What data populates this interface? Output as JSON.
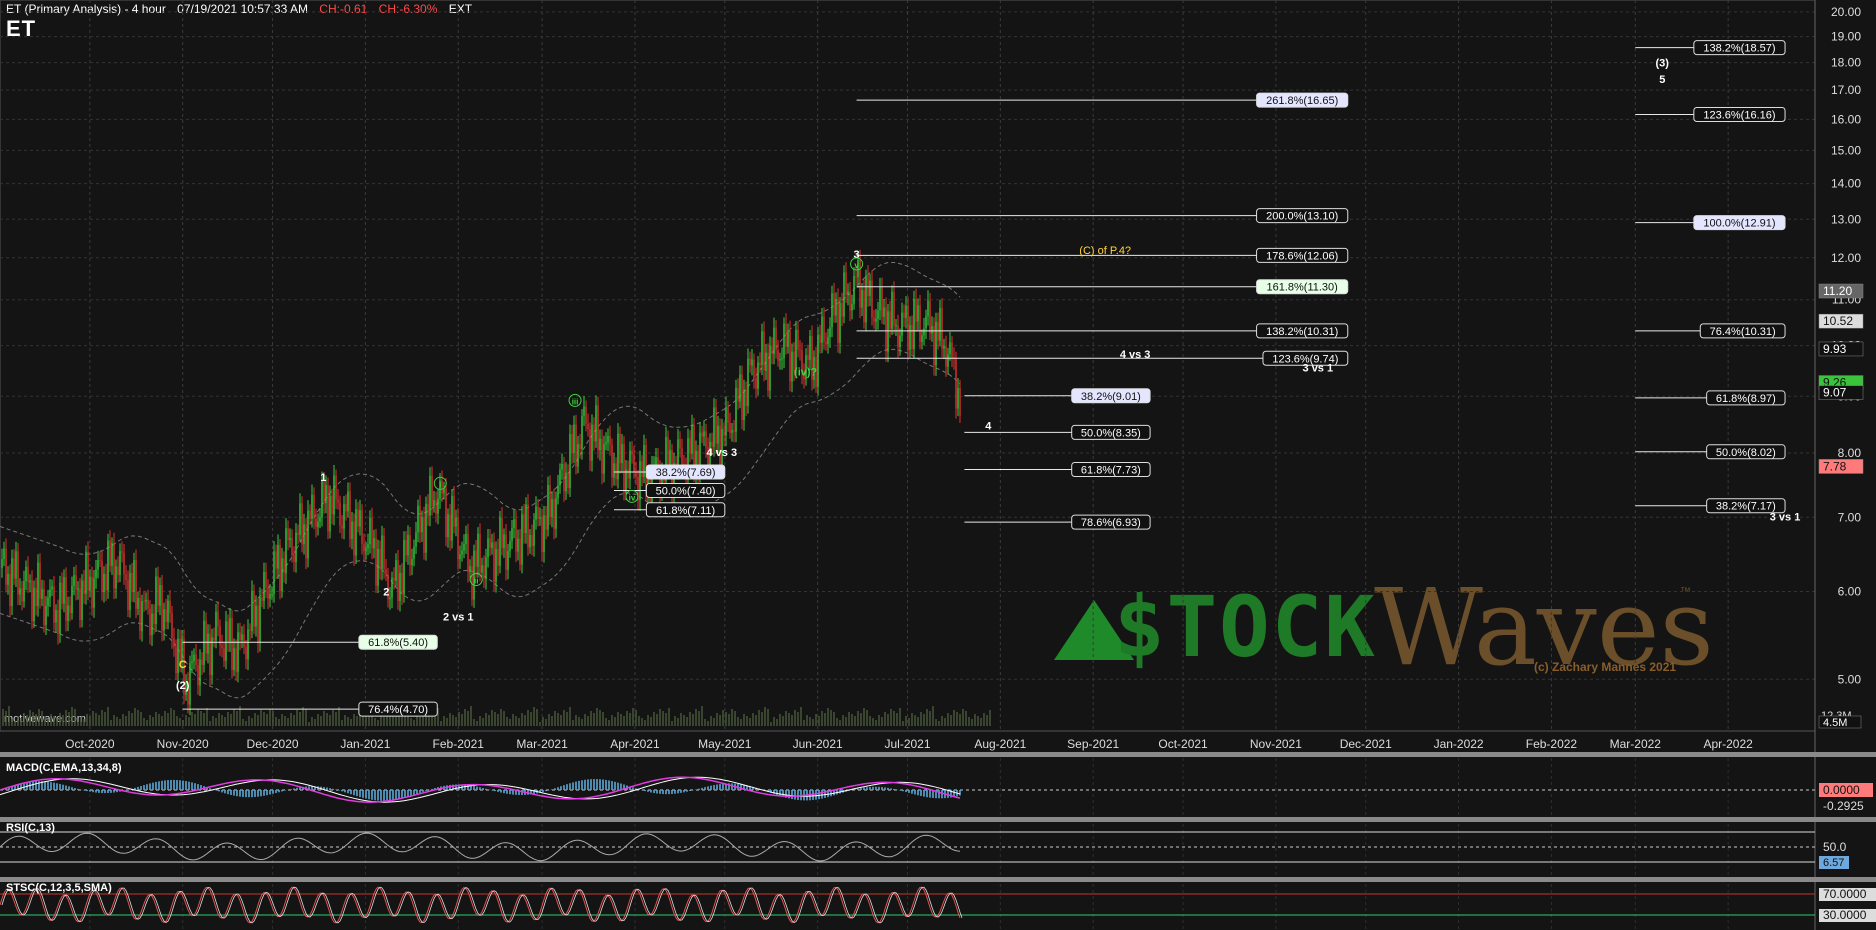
{
  "header": {
    "title": "ET (Primary Analysis) - 4 hour",
    "timestamp": "07/19/2021 10:57:33 AM",
    "ch_abs": "CH:-0.61",
    "ch_pct": "CH:-6.30%",
    "ext": "EXT",
    "symbol": "ET"
  },
  "watermark": "motivewave.com",
  "logo": {
    "brand_left": "$TOCK",
    "brand_right": "Waves",
    "tm": "™",
    "copyright": "(c) Zachary Mannes 2021"
  },
  "chart_data": {
    "type": "candlestick",
    "x_start": "2020-09-01",
    "x_end": "2022-04-30",
    "ylim": [
      4.5,
      20.5
    ],
    "y_scale": "log",
    "price_ticks": [
      "20.00",
      "19.00",
      "18.00",
      "17.00",
      "16.00",
      "15.00",
      "14.00",
      "13.00",
      "12.00",
      "11.00",
      "10.00",
      "9.00",
      "8.00",
      "7.00",
      "6.00",
      "5.00"
    ],
    "x_ticks": [
      "Oct-2020",
      "Nov-2020",
      "Dec-2020",
      "Jan-2021",
      "Feb-2021",
      "Mar-2021",
      "Apr-2021",
      "May-2021",
      "Jun-2021",
      "Jul-2021",
      "Aug-2021",
      "Sep-2021",
      "Oct-2021",
      "Nov-2021",
      "Dec-2021",
      "Jan-2022",
      "Feb-2022",
      "Mar-2022",
      "Apr-2022"
    ],
    "price_path": [
      [
        "2020-09-01",
        6.3
      ],
      [
        "2020-09-20",
        5.8
      ],
      [
        "2020-10-10",
        6.4
      ],
      [
        "2020-10-20",
        5.7
      ],
      [
        "2020-10-25",
        5.9
      ],
      [
        "2020-11-02",
        4.97
      ],
      [
        "2020-11-12",
        5.5
      ],
      [
        "2020-11-20",
        5.3
      ],
      [
        "2020-12-05",
        6.5
      ],
      [
        "2020-12-20",
        7.3
      ],
      [
        "2021-01-05",
        6.5
      ],
      [
        "2021-01-10",
        6.0
      ],
      [
        "2021-01-25",
        7.4
      ],
      [
        "2021-02-05",
        6.3
      ],
      [
        "2021-02-20",
        6.7
      ],
      [
        "2021-03-03",
        7.0
      ],
      [
        "2021-03-15",
        8.5
      ],
      [
        "2021-03-25",
        7.9
      ],
      [
        "2021-04-05",
        7.6
      ],
      [
        "2021-04-20",
        8.0
      ],
      [
        "2021-05-02",
        8.4
      ],
      [
        "2021-05-10",
        9.5
      ],
      [
        "2021-05-20",
        10.0
      ],
      [
        "2021-05-30",
        9.6
      ],
      [
        "2021-06-05",
        10.5
      ],
      [
        "2021-06-14",
        11.4
      ],
      [
        "2021-06-20",
        10.8
      ],
      [
        "2021-06-28",
        10.4
      ],
      [
        "2021-07-07",
        10.5
      ],
      [
        "2021-07-14",
        10.0
      ],
      [
        "2021-07-19",
        8.9
      ]
    ],
    "current_price": "9.26",
    "price_labels_right": [
      {
        "value": 11.2,
        "text": "11.20",
        "style": "grey"
      },
      {
        "value": 10.52,
        "text": "10.52",
        "style": "light"
      },
      {
        "value": 9.93,
        "text": "9.93",
        "style": "dark"
      },
      {
        "value": 9.26,
        "text": "9.26",
        "style": "green"
      },
      {
        "value": 9.07,
        "text": "9.07",
        "style": "dark"
      },
      {
        "value": 7.78,
        "text": "7.78",
        "style": "red"
      }
    ],
    "volume_axis_labels": [
      "12.3M",
      "4.5M"
    ],
    "fib_levels": [
      {
        "x_start": "2021-06-14",
        "x_end": "2021-11-25",
        "value": 16.65,
        "text": "261.8%(16.65)",
        "box": "blue"
      },
      {
        "x_start": "2021-06-14",
        "x_end": "2021-11-25",
        "value": 13.1,
        "text": "200.0%(13.10)",
        "box": "white"
      },
      {
        "x_start": "2021-06-14",
        "x_end": "2021-11-25",
        "value": 12.06,
        "text": "178.6%(12.06)",
        "box": "white"
      },
      {
        "x_start": "2021-06-14",
        "x_end": "2021-11-25",
        "value": 11.3,
        "text": "161.8%(11.30)",
        "box": "green"
      },
      {
        "x_start": "2021-06-14",
        "x_end": "2021-11-25",
        "value": 10.31,
        "text": "138.2%(10.31)",
        "box": "white"
      },
      {
        "x_start": "2021-06-14",
        "x_end": "2021-11-25",
        "value": 9.74,
        "text": "123.6%(9.74)",
        "box": "white"
      },
      {
        "x_start": "2021-07-20",
        "x_end": "2021-09-20",
        "value": 9.01,
        "text": "38.2%(9.01)",
        "box": "blue"
      },
      {
        "x_start": "2021-07-20",
        "x_end": "2021-09-20",
        "value": 8.35,
        "text": "50.0%(8.35)",
        "box": "white"
      },
      {
        "x_start": "2021-07-20",
        "x_end": "2021-09-20",
        "value": 7.73,
        "text": "61.8%(7.73)",
        "box": "white"
      },
      {
        "x_start": "2021-07-20",
        "x_end": "2021-09-20",
        "value": 6.93,
        "text": "78.6%(6.93)",
        "box": "white"
      },
      {
        "x_start": "2021-03-25",
        "x_end": "2021-05-01",
        "value": 7.69,
        "text": "38.2%(7.69)",
        "box": "blue"
      },
      {
        "x_start": "2021-03-25",
        "x_end": "2021-05-01",
        "value": 7.4,
        "text": "50.0%(7.40)",
        "box": "white"
      },
      {
        "x_start": "2021-03-25",
        "x_end": "2021-05-01",
        "value": 7.11,
        "text": "61.8%(7.11)",
        "box": "white"
      },
      {
        "x_start": "2020-11-01",
        "x_end": "2021-01-25",
        "value": 5.4,
        "text": "61.8%(5.40)",
        "box": "green"
      },
      {
        "x_start": "2020-11-01",
        "x_end": "2021-01-25",
        "value": 4.7,
        "text": "76.4%(4.70)",
        "box": "white"
      },
      {
        "x_start": "2022-03-01",
        "x_end": "2022-04-20",
        "value": 18.57,
        "text": "138.2%(18.57)",
        "box": "white"
      },
      {
        "x_start": "2022-03-01",
        "x_end": "2022-04-20",
        "value": 16.16,
        "text": "123.6%(16.16)",
        "box": "white"
      },
      {
        "x_start": "2022-03-01",
        "x_end": "2022-04-20",
        "value": 12.91,
        "text": "100.0%(12.91)",
        "box": "blue"
      },
      {
        "x_start": "2022-03-01",
        "x_end": "2022-04-20",
        "value": 10.31,
        "text": "76.4%(10.31)",
        "box": "white"
      },
      {
        "x_start": "2022-03-01",
        "x_end": "2022-04-20",
        "value": 8.97,
        "text": "61.8%(8.97)",
        "box": "white"
      },
      {
        "x_start": "2022-03-01",
        "x_end": "2022-04-20",
        "value": 8.02,
        "text": "50.0%(8.02)",
        "box": "white"
      },
      {
        "x_start": "2022-03-01",
        "x_end": "2022-04-20",
        "value": 7.17,
        "text": "38.2%(7.17)",
        "box": "white"
      }
    ],
    "wave_labels": [
      {
        "x": "2020-11-01",
        "y": 5.12,
        "text": "C",
        "color": "#ffd23a",
        "circle": false
      },
      {
        "x": "2020-11-01",
        "y": 4.9,
        "text": "(2)",
        "color": "#ffffff",
        "circle": false
      },
      {
        "x": "2020-12-18",
        "y": 7.55,
        "text": "1",
        "color": "#ffffff",
        "circle": false
      },
      {
        "x": "2021-01-08",
        "y": 5.95,
        "text": "2",
        "color": "#ffffff",
        "circle": false
      },
      {
        "x": "2021-01-26",
        "y": 7.45,
        "text": "i",
        "color": "#3fd33f",
        "circle": true
      },
      {
        "x": "2021-02-07",
        "y": 6.1,
        "text": "ii",
        "color": "#3fd33f",
        "circle": true
      },
      {
        "x": "2021-03-12",
        "y": 8.85,
        "text": "iii",
        "color": "#3fd33f",
        "circle": true
      },
      {
        "x": "2021-03-31",
        "y": 7.25,
        "text": "iv",
        "color": "#3fd33f",
        "circle": true
      },
      {
        "x": "2021-06-14",
        "y": 12.0,
        "text": "3",
        "color": "#ffffff",
        "circle": false
      },
      {
        "x": "2021-06-14",
        "y": 11.75,
        "text": "v",
        "color": "#3fd33f",
        "circle": true
      },
      {
        "x": "2021-05-28",
        "y": 9.4,
        "text": "(iv)?",
        "color": "#3fd33f",
        "circle": false
      },
      {
        "x": "2021-07-28",
        "y": 8.4,
        "text": "4",
        "color": "#ffffff",
        "circle": false
      },
      {
        "x": "2022-03-10",
        "y": 17.85,
        "text": "(3)",
        "color": "#ffffff",
        "circle": false
      },
      {
        "x": "2022-03-10",
        "y": 17.25,
        "text": "5",
        "color": "#ffffff",
        "circle": false
      }
    ],
    "annotations": [
      {
        "x": "2021-09-05",
        "y": 12.1,
        "text": "(C) of P.4?",
        "color": "#ffd23a"
      },
      {
        "x": "2021-09-15",
        "y": 9.75,
        "text": "4 vs 3",
        "color": "#ffffff"
      },
      {
        "x": "2021-11-15",
        "y": 9.48,
        "text": "3 vs 1",
        "color": "#ffffff"
      },
      {
        "x": "2021-04-30",
        "y": 7.95,
        "text": "4 vs 3",
        "color": "#ffffff"
      },
      {
        "x": "2021-02-01",
        "y": 5.65,
        "text": "2 vs 1",
        "color": "#ffffff"
      },
      {
        "x": "2022-04-20",
        "y": 6.95,
        "text": "3 vs 1",
        "color": "#ffffff"
      }
    ],
    "macd": {
      "label": "MACD(C,EMA,13,34,8)",
      "values": [
        "0.0000",
        "-0.2925"
      ]
    },
    "rsi": {
      "label": "RSI(C,13)",
      "levels": [
        "50.0",
        "6.57"
      ]
    },
    "stoch": {
      "label": "STSC(C,12,3,5,SMA)",
      "levels": [
        "70.0000",
        "30.0000"
      ]
    }
  }
}
